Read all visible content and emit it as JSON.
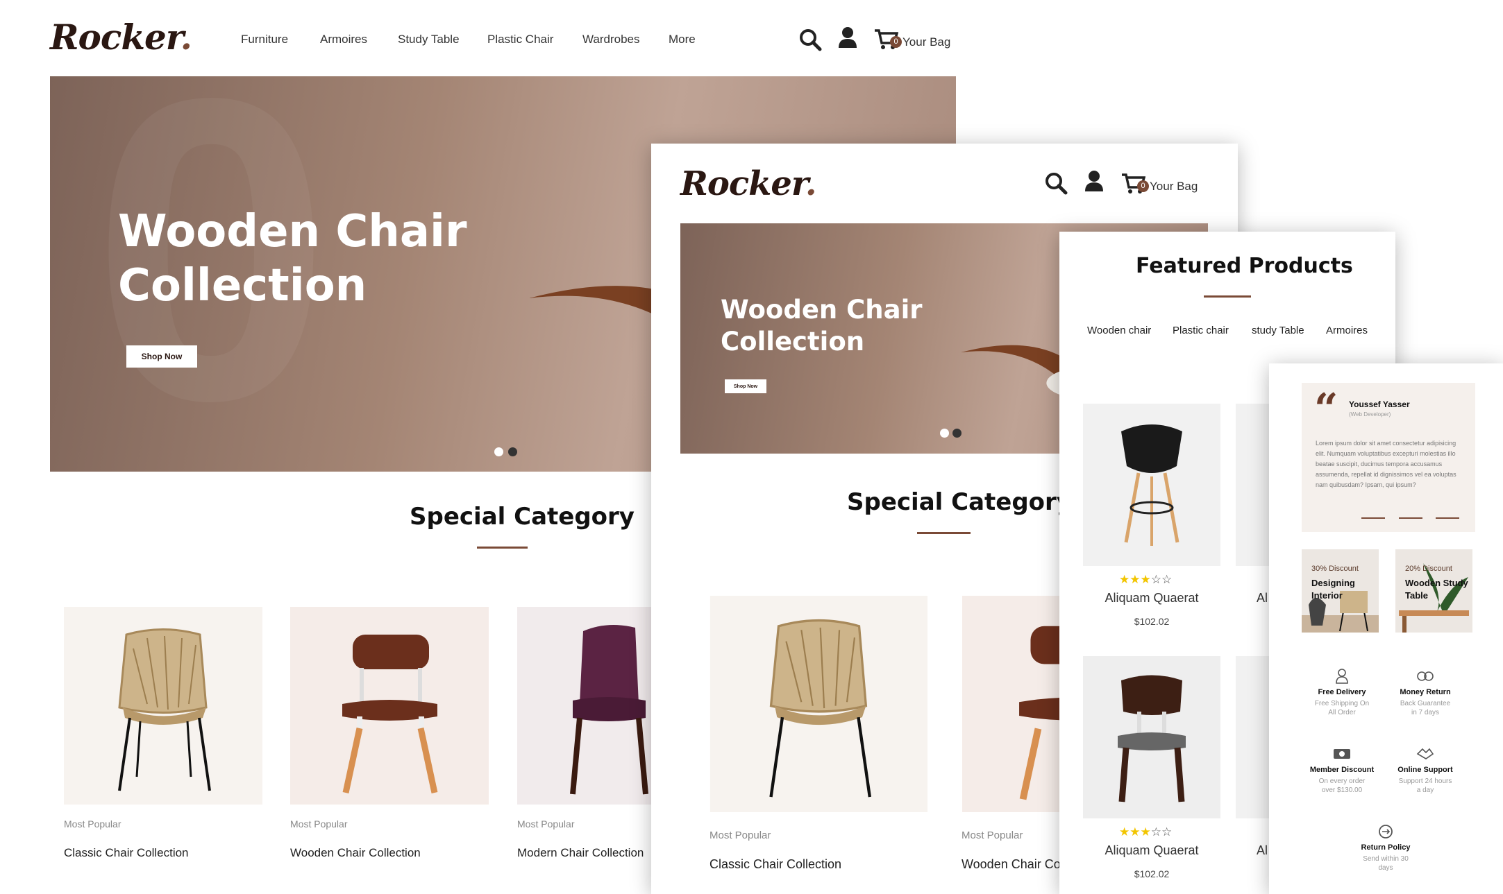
{
  "brand": {
    "logo_text": "Rocker",
    "logo_dot": "."
  },
  "nav": {
    "items": [
      "Furniture",
      "Armoires",
      "Study Table",
      "Plastic Chair",
      "Wardrobes",
      "More"
    ]
  },
  "header": {
    "cart_count": "0",
    "cart_label": "Your Bag"
  },
  "hero": {
    "title_line1": "Wooden Chair",
    "title_line2": "Collection",
    "button_label": "Shop Now"
  },
  "special_category": {
    "title": "Special Category",
    "cards": [
      {
        "label": "Most Popular",
        "title": "Classic Chair Collection"
      },
      {
        "label": "Most Popular",
        "title": "Wooden Chair Collection"
      },
      {
        "label": "Most Popular",
        "title": "Modern Chair Collection"
      }
    ]
  },
  "tablet": {
    "cards": [
      {
        "label": "Most Popular",
        "title": "Classic Chair Collection"
      },
      {
        "label": "Most Popular",
        "title": "Wooden Chair Coll"
      }
    ]
  },
  "featured": {
    "title": "Featured Products",
    "tabs": [
      "Wooden chair",
      "Plastic chair",
      "study Table",
      "Armoires"
    ],
    "products": [
      {
        "name": "Aliquam Quaerat",
        "price": "$102.02",
        "rating": 3,
        "peek": "Al"
      },
      {
        "name": "Aliquam Quaerat",
        "price": "$102.02",
        "rating": 3,
        "peek": "Al"
      }
    ]
  },
  "testimonial": {
    "name": "Youssef Yasser",
    "role": "(Web Developer)",
    "text": "Lorem ipsum dolor sit amet consectetur adipisicing elit. Numquam voluptatibus excepturi molestias illo beatae suscipit, ducimus tempora accusamus assumenda, repellat id dignissimos vel ea voluptas nam quibusdam? Ipsam, qui ipsum?"
  },
  "promos": [
    {
      "discount": "30% Discount",
      "title": "Designing Interior"
    },
    {
      "discount": "20% Discount",
      "title": "Wooden Study Table"
    }
  ],
  "services": [
    {
      "title": "Free Delivery",
      "sub": "Free Shipping On All Order",
      "icon": "user-icon"
    },
    {
      "title": "Money Return",
      "sub": "Back Guarantee in 7 days",
      "icon": "money-icon"
    },
    {
      "title": "Member Discount",
      "sub": "On every order over $130.00",
      "icon": "card-icon"
    },
    {
      "title": "Online Support",
      "sub": "Support 24 hours a day",
      "icon": "handshake-icon"
    },
    {
      "title": "Return Policy",
      "sub": "Send within 30 days",
      "icon": "return-icon"
    }
  ],
  "colors": {
    "brand_brown": "#7a4a36",
    "dark": "#2a1712",
    "star": "#f2c500"
  }
}
